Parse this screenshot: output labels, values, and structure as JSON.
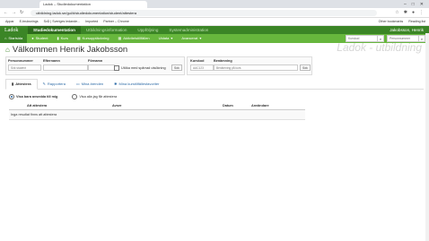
{
  "browser": {
    "tab_title": "Ladok – Studiedokumentation",
    "url": "utbildning.ladok.se/gui/#/studiedokumentation/student/attestera",
    "bookmarks": [
      "Appar",
      "E-bruksnings",
      "SvD | Sveriges ledande...",
      "Imported",
      "Partner – Chrome"
    ],
    "bookmarks_right": [
      "Other bookmarks",
      "Reading list"
    ]
  },
  "ladok_top": {
    "logo": "Ladok",
    "menu": [
      "Studiedokumentation",
      "Utbildningsinformation",
      "Uppföljning",
      "Systemadministration"
    ],
    "user": "Jakobsson, Henrik"
  },
  "ladok_sub": {
    "items": [
      "Startsida",
      "Student",
      "Kurs",
      "Kursupptäckning",
      "Aktivitetstillfällen",
      "Utdata",
      "Avancerat"
    ],
    "search1_placeholder": "Kurskod",
    "search2_placeholder": "Personnummer"
  },
  "page": {
    "title": "Välkommen Henrik Jakobsson",
    "watermark": "Ladok - utbildning"
  },
  "student_search": {
    "personnummer_label": "Personnummer",
    "efternamn_label": "Efternamn",
    "fornamn_label": "Förnamn",
    "personnummer_placeholder": "Sök student",
    "checkbox_label": "Utöka med spärrad utsökning",
    "button": "Sök"
  },
  "course_search": {
    "kurskod_label": "Kurskod",
    "benamning_label": "Benämning",
    "kurskod_placeholder": "AAC123",
    "benamning_placeholder": "Benämning på kurs",
    "button": "Sök"
  },
  "tabs": [
    "Attestera",
    "Rapportera",
    "Mina ärenden",
    "Mina kurstillfällesfavoriter"
  ],
  "filters": {
    "option1": "Visa bara avsedda till mig",
    "option2": "Visa alla jag får attestera"
  },
  "table": {
    "headers": [
      "Att attestera",
      "Avser",
      "Datum",
      "Användare"
    ],
    "empty_text": "Inga resultat finns att attestera"
  }
}
